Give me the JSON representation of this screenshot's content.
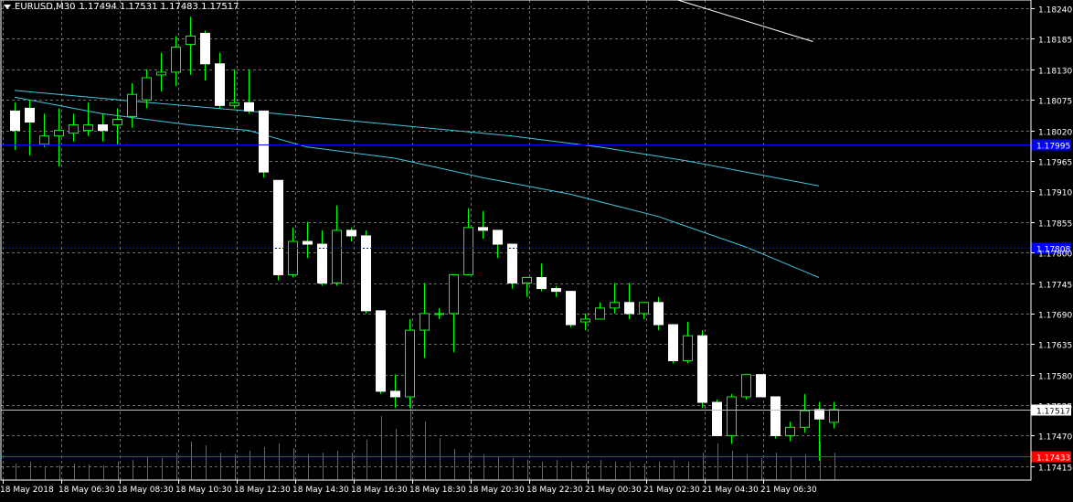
{
  "header": {
    "symbol": "EURUSD,M30",
    "values": "1.17494 1.17531 1.17483 1.17517"
  },
  "colors": {
    "background": "#000000",
    "grid": "#c8c8c8",
    "axis": "#ffffff",
    "bull_candle": "#000000",
    "bear_candle": "#ffffff",
    "wick": "#00ff00",
    "volume": "#00b000",
    "ma_fast": "#40c8e0",
    "ma_slow": "#40c8e0",
    "trendline": "#ffffff",
    "hline_blue": "#0000ff",
    "hline_red": "#ff0000",
    "bid_line": "#c0c0c0"
  },
  "chart_data": {
    "type": "candlestick",
    "symbol": "EURUSD",
    "timeframe": "M30",
    "ylim": [
      1.1739,
      1.18255
    ],
    "y_ticks": [
      "1.18240",
      "1.18185",
      "1.18130",
      "1.18075",
      "1.18020",
      "1.17965",
      "1.17910",
      "1.17855",
      "1.17800",
      "1.17745",
      "1.17690",
      "1.17635",
      "1.17580",
      "1.17525",
      "1.17470",
      "1.17415"
    ],
    "x_ticks": [
      "18 May 2018",
      "18 May 06:30",
      "18 May 08:30",
      "18 May 10:30",
      "18 May 12:30",
      "18 May 14:30",
      "18 May 16:30",
      "18 May 18:30",
      "18 May 20:30",
      "18 May 22:30",
      "21 May 00:30",
      "21 May 02:30",
      "21 May 04:30",
      "21 May 06:30"
    ],
    "candles": [
      [
        1.18055,
        1.1807,
        1.17985,
        1.1802
      ],
      [
        1.1806,
        1.18075,
        1.17975,
        1.18035
      ],
      [
        1.17995,
        1.1805,
        1.1799,
        1.1801
      ],
      [
        1.1801,
        1.1806,
        1.17955,
        1.1802
      ],
      [
        1.18015,
        1.1805,
        1.18,
        1.1803
      ],
      [
        1.1802,
        1.1807,
        1.1801,
        1.1803
      ],
      [
        1.1803,
        1.1805,
        1.18,
        1.1802
      ],
      [
        1.1803,
        1.1806,
        1.17995,
        1.1804
      ],
      [
        1.18045,
        1.18105,
        1.18025,
        1.18085
      ],
      [
        1.18075,
        1.1813,
        1.1806,
        1.18115
      ],
      [
        1.1812,
        1.1816,
        1.1809,
        1.18125
      ],
      [
        1.18125,
        1.1819,
        1.181,
        1.1817
      ],
      [
        1.18175,
        1.18225,
        1.1812,
        1.1819
      ],
      [
        1.18195,
        1.182,
        1.1811,
        1.1814
      ],
      [
        1.1814,
        1.1816,
        1.1806,
        1.18065
      ],
      [
        1.18065,
        1.1813,
        1.1806,
        1.1807
      ],
      [
        1.1807,
        1.1813,
        1.1805,
        1.18055
      ],
      [
        1.18055,
        1.18055,
        1.17935,
        1.17945
      ],
      [
        1.1793,
        1.1793,
        1.1775,
        1.1776
      ],
      [
        1.1776,
        1.17845,
        1.17755,
        1.1782
      ],
      [
        1.1782,
        1.17855,
        1.1779,
        1.17815
      ],
      [
        1.17815,
        1.1784,
        1.1774,
        1.17745
      ],
      [
        1.17745,
        1.17885,
        1.1774,
        1.1784
      ],
      [
        1.1784,
        1.17845,
        1.1782,
        1.1783
      ],
      [
        1.1783,
        1.1784,
        1.1769,
        1.17695
      ],
      [
        1.17695,
        1.17695,
        1.17545,
        1.1755
      ],
      [
        1.1755,
        1.1758,
        1.1752,
        1.1754
      ],
      [
        1.1754,
        1.1768,
        1.1752,
        1.1766
      ],
      [
        1.1766,
        1.17745,
        1.1761,
        1.1769
      ],
      [
        1.1769,
        1.177,
        1.1768,
        1.1769
      ],
      [
        1.1769,
        1.1776,
        1.1762,
        1.1776
      ],
      [
        1.1776,
        1.1788,
        1.1776,
        1.17845
      ],
      [
        1.17845,
        1.17875,
        1.17825,
        1.1784
      ],
      [
        1.1784,
        1.1784,
        1.1779,
        1.17815
      ],
      [
        1.17815,
        1.17815,
        1.17735,
        1.17745
      ],
      [
        1.17745,
        1.17745,
        1.1772,
        1.17755
      ],
      [
        1.17755,
        1.1778,
        1.1773,
        1.17735
      ],
      [
        1.17735,
        1.1774,
        1.1772,
        1.1773
      ],
      [
        1.1773,
        1.1773,
        1.17665,
        1.1767
      ],
      [
        1.17675,
        1.1769,
        1.1766,
        1.1768
      ],
      [
        1.1768,
        1.1771,
        1.1768,
        1.177
      ],
      [
        1.177,
        1.17745,
        1.1769,
        1.1771
      ],
      [
        1.1771,
        1.17745,
        1.1768,
        1.1769
      ],
      [
        1.1769,
        1.177,
        1.1768,
        1.1771
      ],
      [
        1.1771,
        1.1772,
        1.1766,
        1.1767
      ],
      [
        1.1767,
        1.1767,
        1.176,
        1.17605
      ],
      [
        1.17605,
        1.17675,
        1.176,
        1.1765
      ],
      [
        1.1765,
        1.1766,
        1.1752,
        1.1753
      ],
      [
        1.1753,
        1.17535,
        1.1747,
        1.1747
      ],
      [
        1.1747,
        1.17545,
        1.17455,
        1.1754
      ],
      [
        1.1754,
        1.1758,
        1.17535,
        1.1758
      ],
      [
        1.1758,
        1.1758,
        1.1754,
        1.1754
      ],
      [
        1.1754,
        1.1754,
        1.17465,
        1.1747
      ],
      [
        1.1747,
        1.17495,
        1.1746,
        1.17485
      ],
      [
        1.17485,
        1.17545,
        1.17475,
        1.17515
      ],
      [
        1.17517,
        1.17531,
        1.17425,
        1.175
      ],
      [
        1.17494,
        1.17531,
        1.17483,
        1.17517
      ]
    ],
    "ma_fast": [
      [
        0,
        1.18092
      ],
      [
        8,
        1.18073
      ],
      [
        16,
        1.18055
      ],
      [
        22,
        1.1804
      ],
      [
        28,
        1.18025
      ],
      [
        34,
        1.1801
      ],
      [
        40,
        1.1799
      ],
      [
        46,
        1.17965
      ],
      [
        52,
        1.17935
      ],
      [
        55,
        1.1792
      ]
    ],
    "ma_slow": [
      [
        0,
        1.1808
      ],
      [
        6,
        1.1805
      ],
      [
        12,
        1.1803
      ],
      [
        16,
        1.1802
      ],
      [
        20,
        1.1799
      ],
      [
        26,
        1.1797
      ],
      [
        32,
        1.17935
      ],
      [
        38,
        1.17905
      ],
      [
        44,
        1.17865
      ],
      [
        50,
        1.1781
      ],
      [
        55,
        1.17755
      ]
    ],
    "trendline": [
      [
        43.5,
        1.1827
      ],
      [
        54.6,
        1.1818
      ]
    ],
    "hlines": [
      {
        "price": 1.17995,
        "label": "1.17995",
        "color": "#0000ff",
        "style": "solid"
      },
      {
        "price": 1.17808,
        "label": "1.17808",
        "color": "#0000ff",
        "style": "dashed"
      },
      {
        "price": 1.17433,
        "label": "1.17433",
        "color": "#ff0000",
        "style": "solid"
      }
    ],
    "bid": {
      "price": 1.17517,
      "label": "1.17517"
    },
    "volume_scale": 100,
    "volumes": [
      18,
      20,
      15,
      16,
      18,
      17,
      16,
      20,
      22,
      26,
      24,
      30,
      42,
      38,
      30,
      28,
      32,
      36,
      40,
      35,
      28,
      30,
      32,
      30,
      44,
      70,
      56,
      90,
      64,
      46,
      34,
      30,
      28,
      26,
      24,
      22,
      20,
      22,
      20,
      18,
      22,
      20,
      20,
      18,
      20,
      22,
      20,
      30,
      40,
      32,
      28,
      24,
      30,
      26,
      28,
      42,
      30
    ],
    "grid": true
  }
}
